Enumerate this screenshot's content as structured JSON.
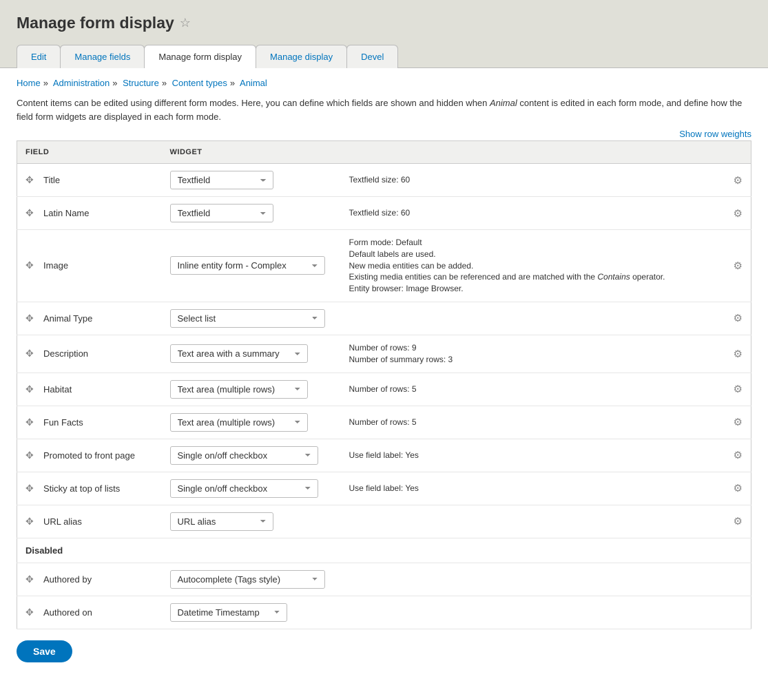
{
  "page_title": "Manage form display",
  "tabs": [
    {
      "label": "Edit"
    },
    {
      "label": "Manage fields"
    },
    {
      "label": "Manage form display"
    },
    {
      "label": "Manage display"
    },
    {
      "label": "Devel"
    }
  ],
  "breadcrumb": [
    {
      "label": "Home"
    },
    {
      "label": "Administration"
    },
    {
      "label": "Structure"
    },
    {
      "label": "Content types"
    },
    {
      "label": "Animal"
    }
  ],
  "help_prefix": "Content items can be edited using different form modes. Here, you can define which fields are shown and hidden when ",
  "help_em": "Animal",
  "help_suffix": " content is edited in each form mode, and define how the field form widgets are displayed in each form mode.",
  "show_row_weights": "Show row weights",
  "headers": {
    "field": "Field",
    "widget": "Widget"
  },
  "rows": [
    {
      "field": "Title",
      "widget": "Textfield",
      "wclass": "w150",
      "summary": "Textfield size: 60",
      "gear": true
    },
    {
      "field": "Latin Name",
      "widget": "Textfield",
      "wclass": "w150",
      "summary": "Textfield size: 60",
      "gear": true
    },
    {
      "field": "Image",
      "widget": "Inline entity form - Complex",
      "wclass": "w225",
      "summary_lines": [
        "Form mode: Default",
        "Default labels are used.",
        "New media entities can be added."
      ],
      "summary_html_prefix": "Existing media entities can be referenced and are matched with the ",
      "summary_html_em": "Contains",
      "summary_html_suffix": " operator.",
      "summary_last": "Entity browser: Image Browser.",
      "gear": true
    },
    {
      "field": "Animal Type",
      "widget": "Select list",
      "wclass": "w225",
      "summary": "",
      "gear": true
    },
    {
      "field": "Description",
      "widget": "Text area with a summary",
      "wclass": "w200",
      "summary_lines": [
        "Number of rows: 9",
        "Number of summary rows: 3"
      ],
      "gear": true
    },
    {
      "field": "Habitat",
      "widget": "Text area (multiple rows)",
      "wclass": "w200",
      "summary": "Number of rows: 5",
      "gear": true
    },
    {
      "field": "Fun Facts",
      "widget": "Text area (multiple rows)",
      "wclass": "w200",
      "summary": "Number of rows: 5",
      "gear": true
    },
    {
      "field": "Promoted to front page",
      "widget": "Single on/off checkbox",
      "wclass": "w215",
      "summary": "Use field label: Yes",
      "gear": true
    },
    {
      "field": "Sticky at top of lists",
      "widget": "Single on/off checkbox",
      "wclass": "w215",
      "summary": "Use field label: Yes",
      "gear": true
    },
    {
      "field": "URL alias",
      "widget": "URL alias",
      "wclass": "w150",
      "summary": "",
      "gear": true
    }
  ],
  "disabled_label": "Disabled",
  "disabled_rows": [
    {
      "field": "Authored by",
      "widget": "Autocomplete (Tags style)",
      "wclass": "w225",
      "summary": "",
      "gear": false
    },
    {
      "field": "Authored on",
      "widget": "Datetime Timestamp",
      "wclass": "w170",
      "summary": "",
      "gear": false
    }
  ],
  "save_label": "Save"
}
